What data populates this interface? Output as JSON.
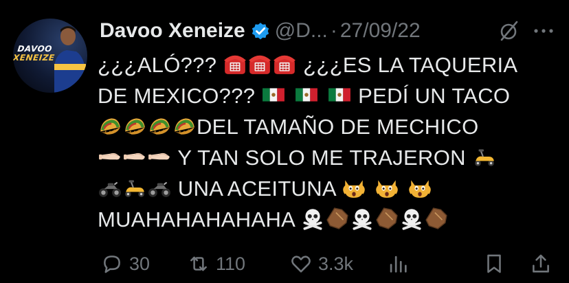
{
  "author": {
    "display_name": "Davoo Xeneize",
    "handle": "@D...",
    "date": "27/09/22",
    "verified": true,
    "avatar_text_line1": "DAVOO",
    "avatar_text_line2": "XENEIZE",
    "avatar_icon": "avatar-photo"
  },
  "header": {
    "separator": "·",
    "mute_icon": "mute-icon",
    "more_icon": "more-icon"
  },
  "tweet": {
    "segments": {
      "l1a": "¿¿¿ALÓ???",
      "l1b": "¿¿¿ES LA TAQUERIA",
      "l2a": "DE MEXICO???",
      "l2b": "PEDÍ UN TACO",
      "l3a": "DEL TAMAÑO DE MECHICO",
      "l4a": "Y TAN SOLO ME TRAJERON",
      "l5a": "UNA ACEITUNA",
      "l6a": "MUAHAHAHAHAHA"
    },
    "emoji_names": [
      "telephone",
      "mexico-flag",
      "taco",
      "pinching-hand",
      "motor-scooter",
      "motorcycle",
      "screaming-cat",
      "skull-and-crossbones",
      "coffin"
    ]
  },
  "actions": {
    "reply_count": "30",
    "retweet_count": "110",
    "like_count": "3.3k",
    "views_icon": "views-icon",
    "bookmark_icon": "bookmark-icon",
    "share_icon": "share-icon"
  },
  "colors": {
    "background": "#000000",
    "text": "#e7e9ea",
    "secondary": "#71767b",
    "verified_blue": "#1d9bf0"
  }
}
